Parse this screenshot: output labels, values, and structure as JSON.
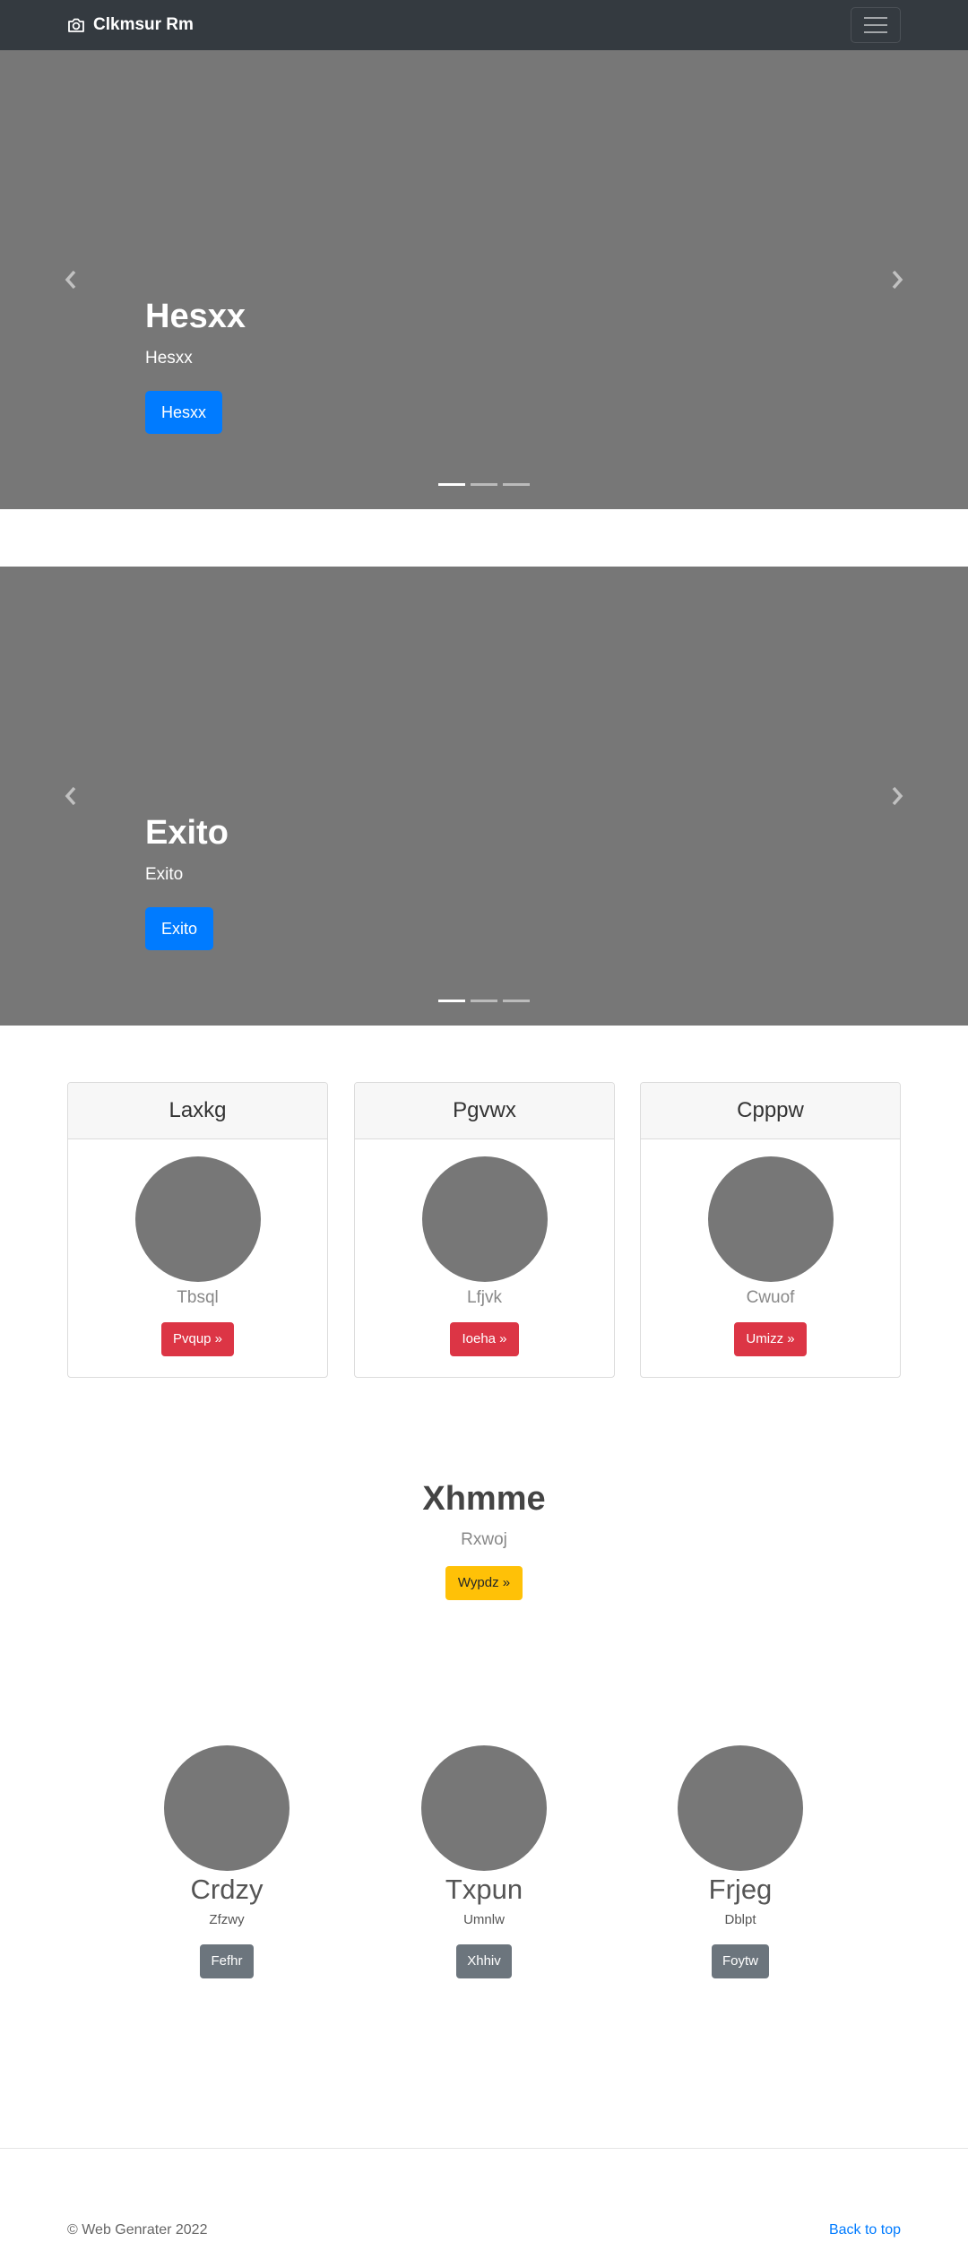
{
  "navbar": {
    "brand": "Clkmsur Rm",
    "brand_icon": "camera-icon",
    "toggler_icon": "hamburger-icon"
  },
  "carousel1": {
    "title": "Hesxx",
    "text": "Hesxx",
    "button": "Hesxx"
  },
  "carousel2": {
    "title": "Exito",
    "text": "Exito",
    "button": "Exito"
  },
  "cards": [
    {
      "header": "Laxkg",
      "sub": "Tbsql",
      "button": "Pvqup »"
    },
    {
      "header": "Pgvwx",
      "sub": "Lfjvk",
      "button": "Ioeha »"
    },
    {
      "header": "Cpppw",
      "sub": "Cwuof",
      "button": "Umizz »"
    }
  ],
  "hero": {
    "title": "Xhmme",
    "sub": "Rxwoj",
    "button": "Wypdz »"
  },
  "features": [
    {
      "title": "Crdzy",
      "sub": "Zfzwy",
      "button": "Fefhr"
    },
    {
      "title": "Txpun",
      "sub": "Umnlw",
      "button": "Xhhiv"
    },
    {
      "title": "Frjeg",
      "sub": "Dblpt",
      "button": "Foytw"
    }
  ],
  "footer": {
    "copyright": "© Web Genrater 2022",
    "back_to_top": "Back to top"
  },
  "colors": {
    "navbar": "#343a40",
    "placeholder": "#777777",
    "primary": "#007bff",
    "danger": "#dc3545",
    "warning": "#ffc107",
    "secondary": "#6c757d"
  }
}
